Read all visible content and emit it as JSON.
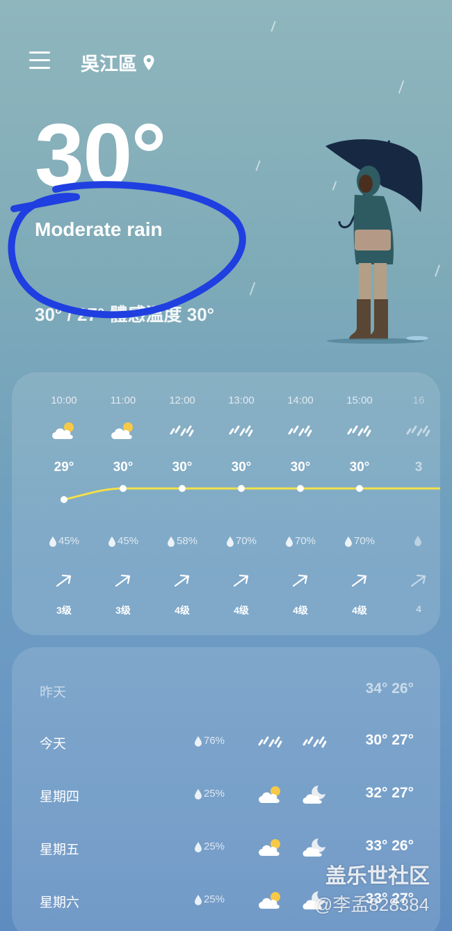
{
  "header": {
    "location": "吳江區",
    "menu_icon": "hamburger-menu-icon",
    "location_icon": "location-pin-icon"
  },
  "current": {
    "temperature": "30°",
    "condition": "Moderate rain",
    "hi_lo_feels": "30° / 27° 體感溫度 30°"
  },
  "hourly": [
    {
      "time": "10:00",
      "icon": "partly-cloudy-icon",
      "temp": "29°",
      "rain": "45%",
      "wind_level": "3级"
    },
    {
      "time": "11:00",
      "icon": "partly-cloudy-icon",
      "temp": "30°",
      "rain": "45%",
      "wind_level": "3级"
    },
    {
      "time": "12:00",
      "icon": "rain-icon",
      "temp": "30°",
      "rain": "58%",
      "wind_level": "4级"
    },
    {
      "time": "13:00",
      "icon": "rain-icon",
      "temp": "30°",
      "rain": "70%",
      "wind_level": "4级"
    },
    {
      "time": "14:00",
      "icon": "rain-icon",
      "temp": "30°",
      "rain": "70%",
      "wind_level": "4级"
    },
    {
      "time": "15:00",
      "icon": "rain-icon",
      "temp": "30°",
      "rain": "70%",
      "wind_level": "4级"
    },
    {
      "time": "16",
      "icon": "rain-icon",
      "temp": "3",
      "rain": "",
      "wind_level": "4"
    }
  ],
  "daily": [
    {
      "day": "昨天",
      "rain": "",
      "icon_day": "",
      "icon_night": "",
      "temps": "34° 26°"
    },
    {
      "day": "今天",
      "rain": "76%",
      "icon_day": "rain-icon",
      "icon_night": "rain-icon",
      "temps": "30° 27°"
    },
    {
      "day": "星期四",
      "rain": "25%",
      "icon_day": "partly-cloudy-icon",
      "icon_night": "cloudy-moon-icon",
      "temps": "32° 27°"
    },
    {
      "day": "星期五",
      "rain": "25%",
      "icon_day": "partly-cloudy-icon",
      "icon_night": "cloudy-moon-icon",
      "temps": "33° 26°"
    },
    {
      "day": "星期六",
      "rain": "25%",
      "icon_day": "partly-cloudy-icon",
      "icon_night": "cloudy-moon-icon",
      "temps": "33° 27°"
    }
  ],
  "watermark": {
    "line1": "盖乐世社区",
    "line2": "@李孟828384"
  },
  "colors": {
    "temp_line": "#f2e04a",
    "annotation": "#1f3fe0"
  }
}
